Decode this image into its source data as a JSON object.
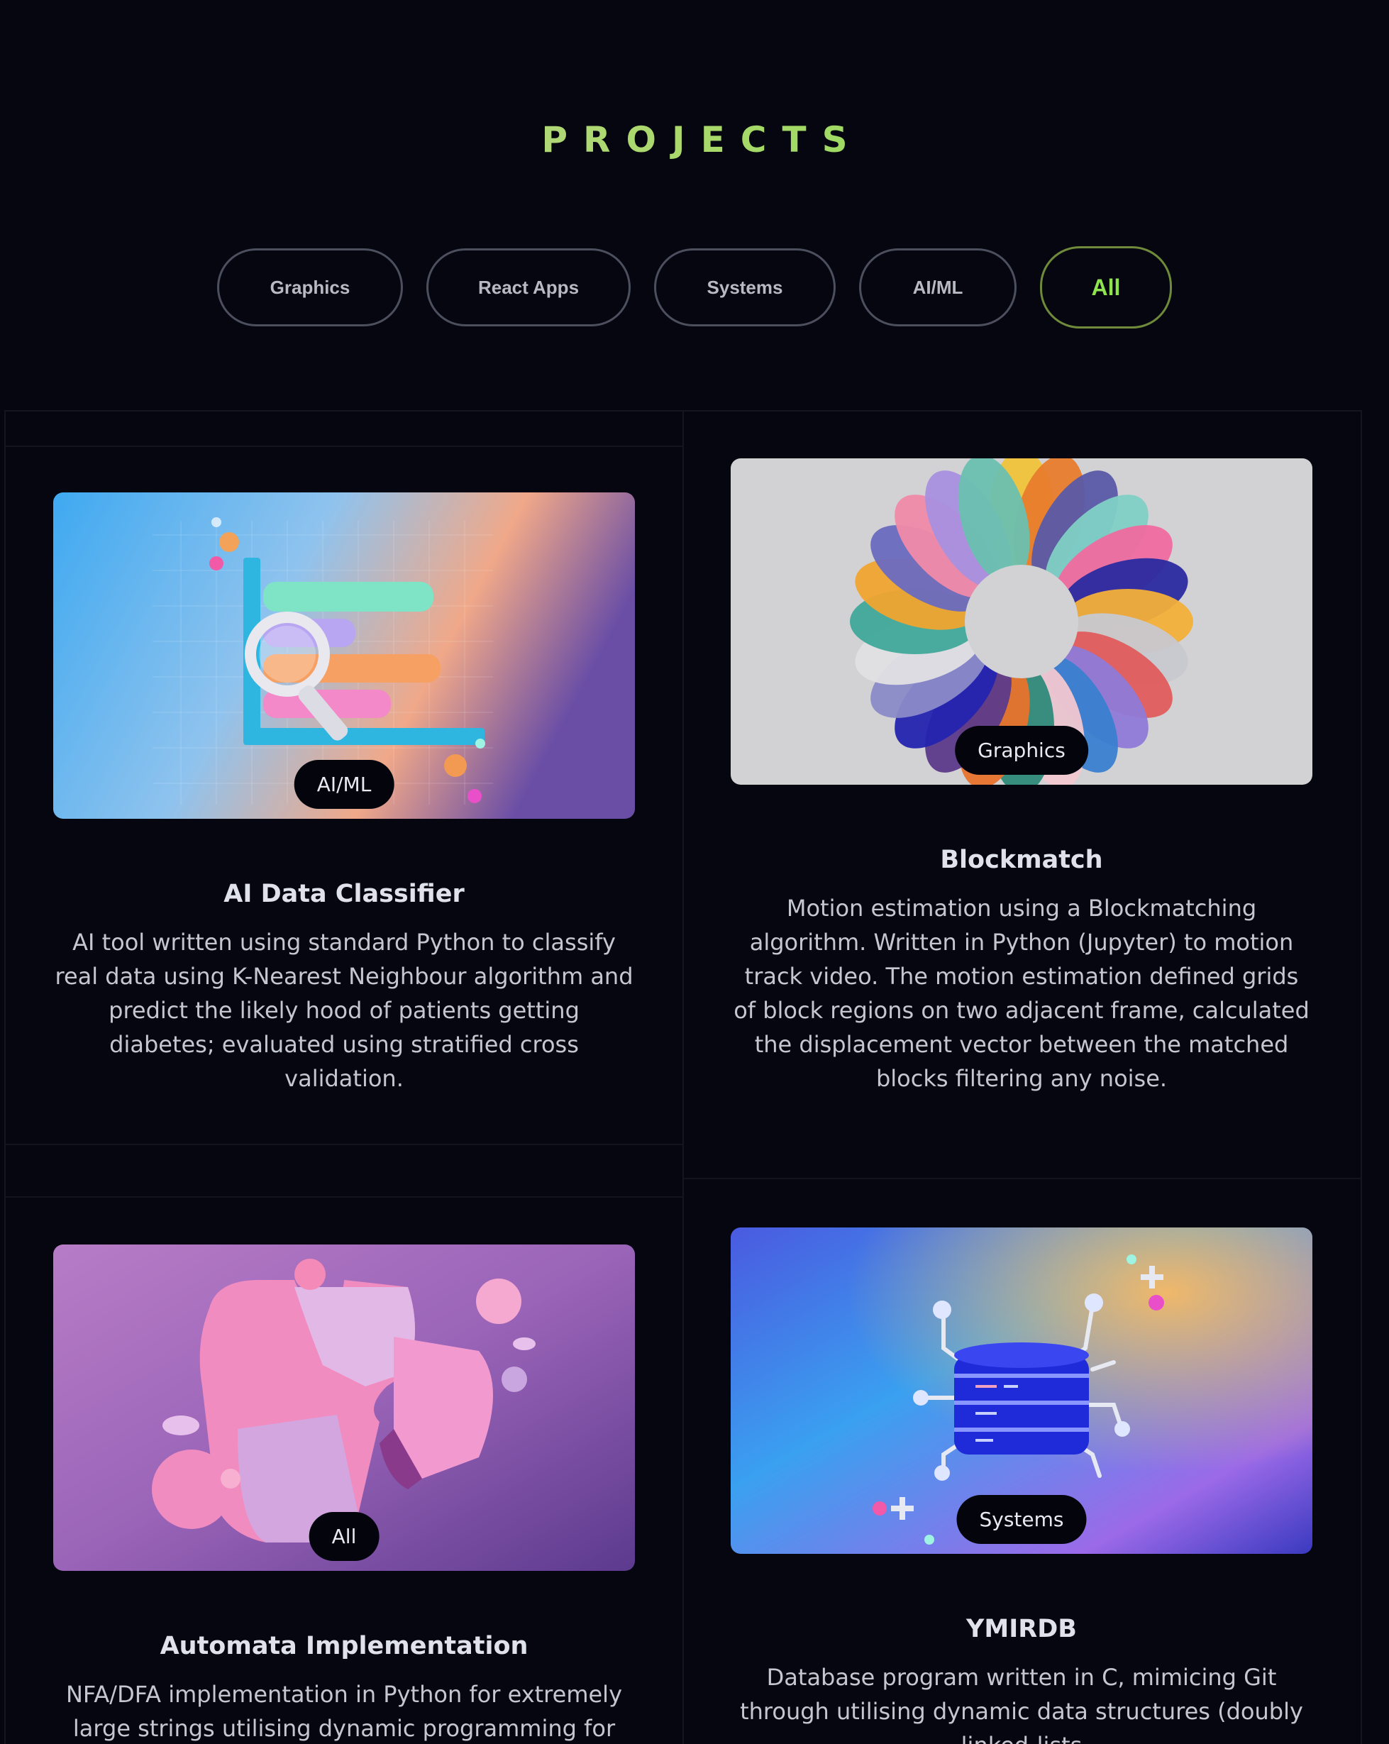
{
  "section": {
    "title": "PROJECTS"
  },
  "filters": [
    {
      "label": "Graphics",
      "active": false
    },
    {
      "label": "React Apps",
      "active": false
    },
    {
      "label": "Systems",
      "active": false
    },
    {
      "label": "AI/ML",
      "active": false
    },
    {
      "label": "All",
      "active": true
    }
  ],
  "projects": [
    {
      "category": "AI/ML",
      "name": "AI Data Classifier",
      "description": "AI tool written using standard Python to classify real data using K-Nearest Neighbour algorithm and predict the likely hood of patients getting diabetes; evaluated using stratified cross validation.",
      "image_icon": "bar-chart-magnifier-icon"
    },
    {
      "category": "Graphics",
      "name": "Blockmatch",
      "description": "Motion estimation using a Blockmatching algorithm. Written in Python (Jupyter) to motion track video. The motion estimation defined grids of block regions on two adjacent frame, calculated the displacement vector between the matched blocks filtering any noise.",
      "image_icon": "color-swatch-spiral-icon"
    },
    {
      "category": "All",
      "name": "Automata Implementation",
      "description": "NFA/DFA implementation in Python for extremely large strings utilising dynamic programming for efficiency.",
      "image_icon": "puzzle-pieces-icon"
    },
    {
      "category": "Systems",
      "name": "YMIRDB",
      "description": "Database program written in C, mimicing Git through utilising dynamic data structures (doubly linked-lists",
      "image_icon": "database-server-icon"
    }
  ],
  "colors": {
    "background": "#05060f",
    "accent": "#8fe34e",
    "card_badge": "#04050c"
  }
}
